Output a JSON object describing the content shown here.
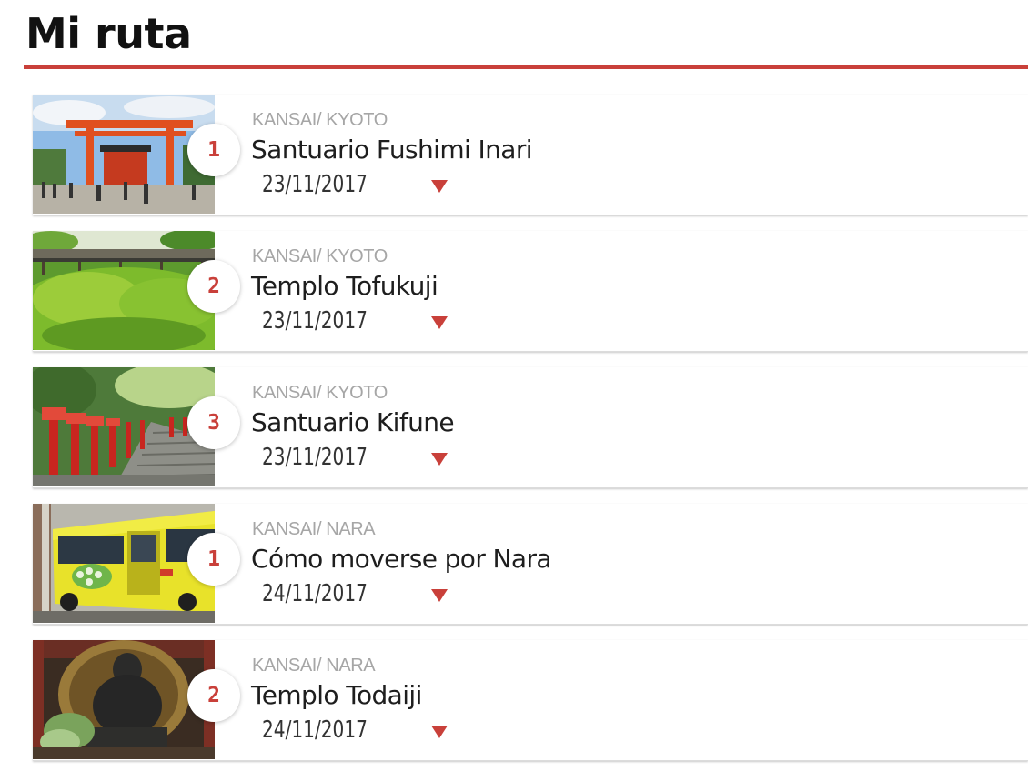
{
  "page": {
    "title": "Mi ruta"
  },
  "colors": {
    "accent": "#c9403a"
  },
  "route": [
    {
      "order": "1",
      "region": "KANSAI/ KYOTO",
      "title": "Santuario Fushimi Inari",
      "date": "23/11/2017",
      "image": "torii-gate-photo"
    },
    {
      "order": "2",
      "region": "KANSAI/ KYOTO",
      "title": "Templo Tofukuji",
      "date": "23/11/2017",
      "image": "maple-garden-photo"
    },
    {
      "order": "3",
      "region": "KANSAI/ KYOTO",
      "title": "Santuario Kifune",
      "date": "23/11/2017",
      "image": "lantern-stairs-photo"
    },
    {
      "order": "1",
      "region": "KANSAI/ NARA",
      "title": "Cómo moverse por Nara",
      "date": "24/11/2017",
      "image": "yellow-bus-photo"
    },
    {
      "order": "2",
      "region": "KANSAI/ NARA",
      "title": "Templo Todaiji",
      "date": "24/11/2017",
      "image": "buddha-statue-photo"
    }
  ]
}
